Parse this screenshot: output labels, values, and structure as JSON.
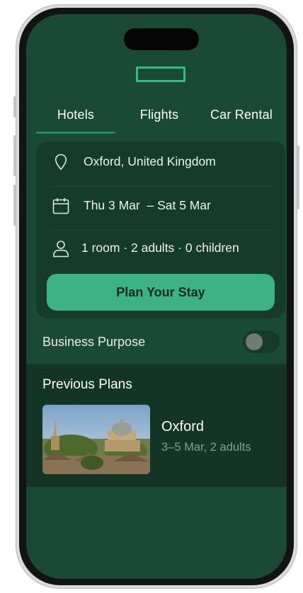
{
  "tabs": [
    {
      "label": "Hotels",
      "active": true
    },
    {
      "label": "Flights",
      "active": false
    },
    {
      "label": "Car Rental",
      "active": false
    }
  ],
  "search": {
    "location": "Oxford, United Kingdom",
    "dates": "Thu 3 Mar  – Sat 5 Mar",
    "guests": "1 room · 2 adults · 0 children",
    "submit_label": "Plan Your Stay"
  },
  "business_purpose": {
    "label": "Business Purpose",
    "enabled": false
  },
  "previous_plans": {
    "title": "Previous Plans",
    "items": [
      {
        "city": "Oxford",
        "details": "3–5 Mar, 2 adults"
      }
    ]
  },
  "icons": [
    "location-pin-icon",
    "calendar-icon",
    "person-icon"
  ],
  "colors": {
    "background": "#1a4a35",
    "card": "#163b2b",
    "accent": "#3db283",
    "logo": "#2fbf80"
  }
}
